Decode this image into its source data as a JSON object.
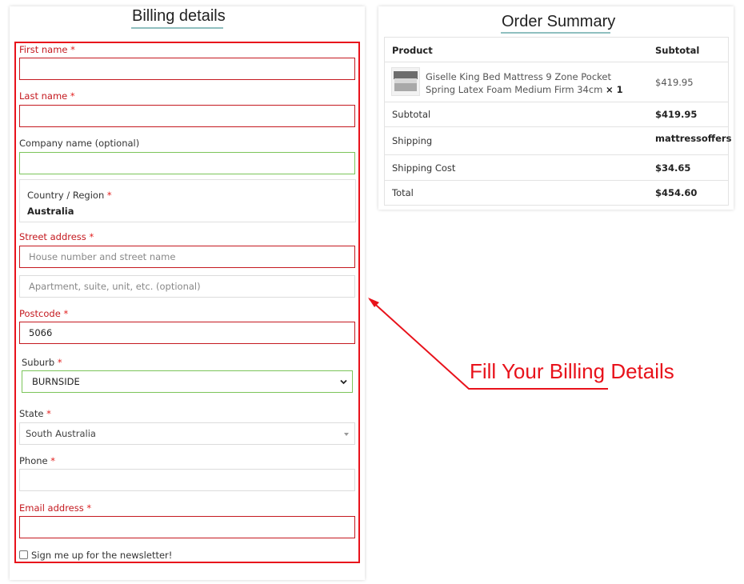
{
  "billing": {
    "title": "Billing details",
    "first_name_label": "First name",
    "last_name_label": "Last name",
    "company_label": "Company name (optional)",
    "country_label": "Country / Region",
    "country_value": "Australia",
    "street_label": "Street address",
    "street_placeholder": "House number and street name",
    "apartment_placeholder": "Apartment, suite, unit, etc. (optional)",
    "postcode_label": "Postcode",
    "postcode_value": "5066",
    "suburb_label": "Suburb",
    "suburb_value": "BURNSIDE",
    "state_label": "State",
    "state_value": "South Australia",
    "phone_label": "Phone",
    "email_label": "Email address",
    "newsletter_label": "Sign me up for the newsletter!",
    "required_mark": "*"
  },
  "order": {
    "title": "Order Summary",
    "col_product": "Product",
    "col_subtotal": "Subtotal",
    "item_name": "Giselle King Bed Mattress 9 Zone Pocket Spring Latex Foam Medium Firm 34cm",
    "item_qty": "× 1",
    "item_price": "$419.95",
    "subtotal_label": "Subtotal",
    "subtotal_value": "$419.95",
    "shipping_label": "Shipping",
    "shipping_value": "mattressoffers",
    "shipping_cost_label": "Shipping Cost",
    "shipping_cost_value": "$34.65",
    "total_label": "Total",
    "total_value": "$454.60"
  },
  "annotation": {
    "text": "Fill Your Billing Details",
    "color": "#e8121b"
  },
  "colors": {
    "error_red": "#c4191f",
    "valid_green": "#7cc55a",
    "title_underline": "#8fbfbf"
  }
}
